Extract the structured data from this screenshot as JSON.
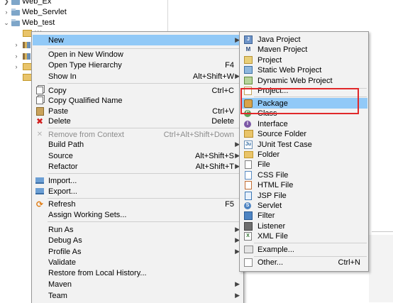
{
  "explorer": {
    "projects": [
      "Web_Ex",
      "Web_Servlet",
      "Web_test"
    ],
    "child_label": "***"
  },
  "context_menu": {
    "new_label": "New",
    "open_new_window": "Open in New Window",
    "open_type_hierarchy": "Open Type Hierarchy",
    "open_type_hierarchy_key": "F4",
    "show_in": "Show In",
    "show_in_key": "Alt+Shift+W",
    "copy": "Copy",
    "copy_key": "Ctrl+C",
    "copy_qualified": "Copy Qualified Name",
    "paste": "Paste",
    "paste_key": "Ctrl+V",
    "delete": "Delete",
    "delete_key": "Delete",
    "remove_context": "Remove from Context",
    "remove_context_key": "Ctrl+Alt+Shift+Down",
    "build_path": "Build Path",
    "source": "Source",
    "source_key": "Alt+Shift+S",
    "refactor": "Refactor",
    "refactor_key": "Alt+Shift+T",
    "import": "Import...",
    "export": "Export...",
    "refresh": "Refresh",
    "refresh_key": "F5",
    "assign_working_sets": "Assign Working Sets...",
    "run_as": "Run As",
    "debug_as": "Debug As",
    "profile_as": "Profile As",
    "validate": "Validate",
    "restore_history": "Restore from Local History...",
    "maven": "Maven",
    "team": "Team"
  },
  "new_submenu": {
    "java_project": "Java Project",
    "maven_project": "Maven Project",
    "project": "Project",
    "static_web_project": "Static Web Project",
    "dynamic_web_project": "Dynamic Web Project",
    "project_dots": "Project...",
    "package": "Package",
    "class": "Class",
    "interface": "Interface",
    "source_folder": "Source Folder",
    "junit_test_case": "JUnit Test Case",
    "folder": "Folder",
    "file": "File",
    "css_file": "CSS File",
    "html_file": "HTML File",
    "jsp_file": "JSP File",
    "servlet": "Servlet",
    "filter": "Filter",
    "listener": "Listener",
    "xml_file": "XML File",
    "example": "Example...",
    "other": "Other...",
    "other_key": "Ctrl+N"
  },
  "colors": {
    "highlight": "#91c9f7",
    "annotation_box": "#e0282a",
    "menu_bg": "#f2f2f2"
  }
}
